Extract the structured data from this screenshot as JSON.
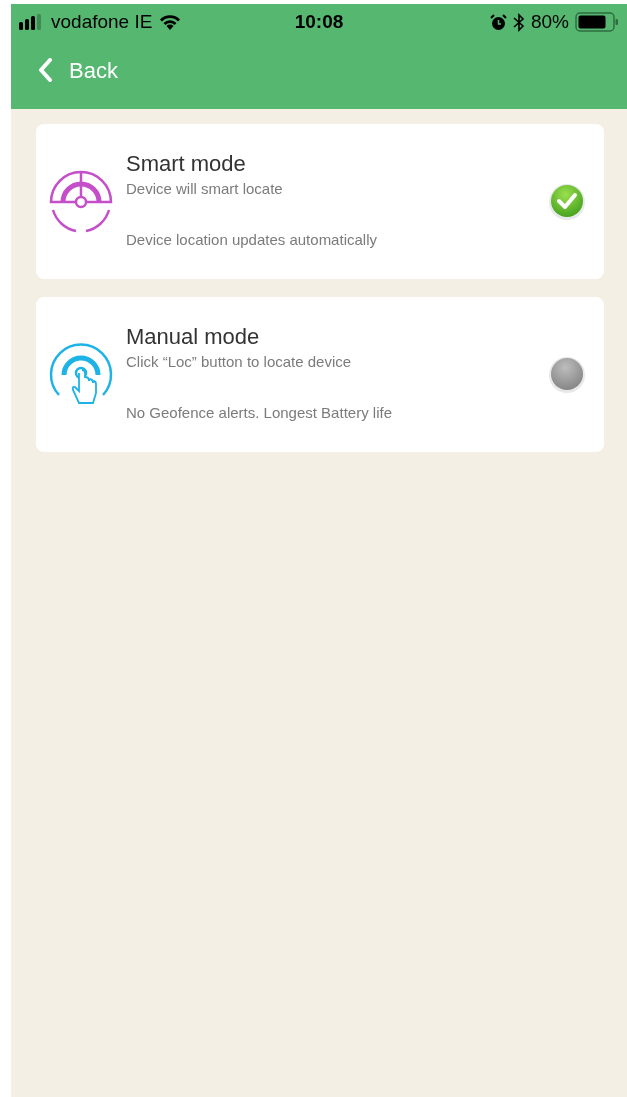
{
  "status_bar": {
    "carrier": "vodafone IE",
    "time": "10:08",
    "battery": "80%"
  },
  "nav": {
    "back": "Back"
  },
  "modes": [
    {
      "kind": "smart",
      "title": "Smart mode",
      "subtitle": "Device will smart locate",
      "note": "Device location updates automatically",
      "selected": true
    },
    {
      "kind": "manual",
      "title": "Manual mode",
      "subtitle": "Click “Loc” button to locate device",
      "note": "No Geofence alerts. Longest Battery life",
      "selected": false
    }
  ]
}
